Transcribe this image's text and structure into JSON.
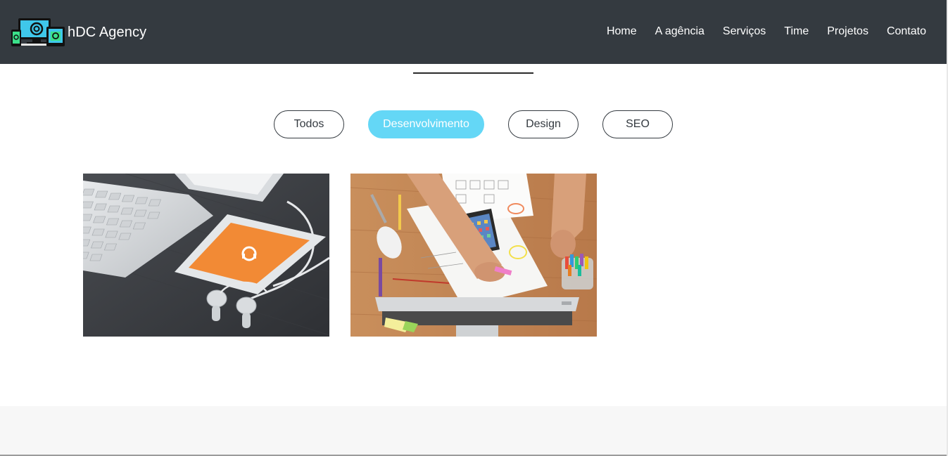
{
  "brand": {
    "name": "hDC Agency",
    "logo_icon": "devices-logo-icon"
  },
  "nav": {
    "items": [
      {
        "label": "Home"
      },
      {
        "label": "A agência"
      },
      {
        "label": "Serviços"
      },
      {
        "label": "Time"
      },
      {
        "label": "Projetos"
      },
      {
        "label": "Contato"
      }
    ]
  },
  "filters": {
    "items": [
      {
        "label": "Todos"
      },
      {
        "label": "Desenvolvimento"
      },
      {
        "label": "Design"
      },
      {
        "label": "SEO"
      }
    ],
    "active": "Desenvolvimento"
  },
  "projects": [
    {
      "image": "phone-keyboard-earphones-photo"
    },
    {
      "image": "desk-sketching-workspace-photo"
    }
  ],
  "colors": {
    "navbar": "#343a40",
    "accent": "#64d7f6",
    "footer_band": "#f7f7f7"
  }
}
